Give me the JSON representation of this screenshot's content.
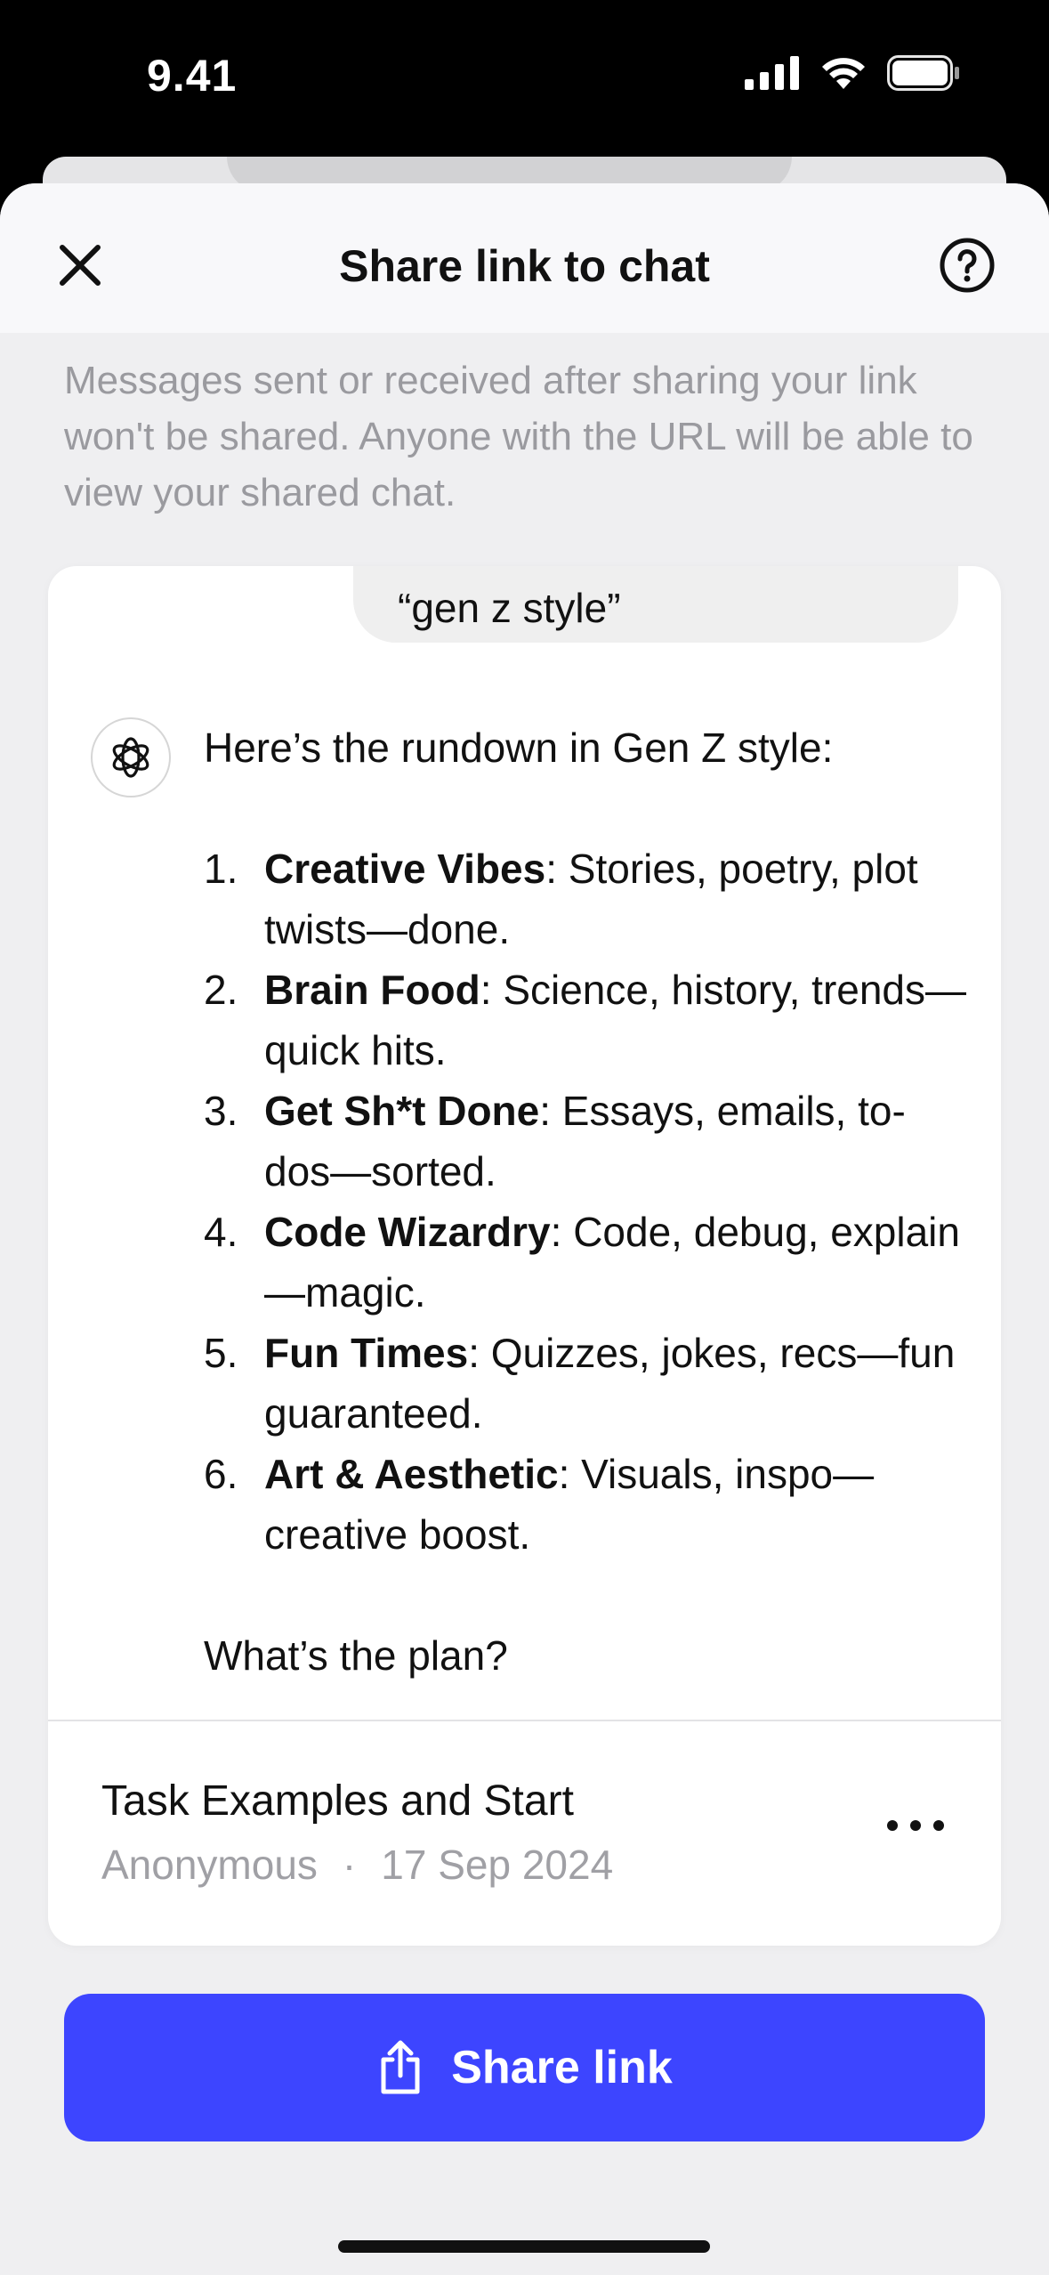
{
  "status_bar": {
    "time": "9.41",
    "icons": [
      "cellular-signal-icon",
      "wifi-icon",
      "battery-icon"
    ]
  },
  "header": {
    "title": "Share link to chat",
    "close_icon": "close-icon",
    "help_icon": "help-icon"
  },
  "description": "Messages sent or received after sharing your link won't be shared. Anyone with the URL will be able to view your shared chat.",
  "conversation": {
    "user_message": "“gen z style”",
    "assistant": {
      "avatar_icon": "openai-logo-icon",
      "intro": "Here’s the rundown in Gen Z style:",
      "items": [
        {
          "num": "1.",
          "title": "Creative Vibes",
          "text": ": Stories, poetry, plot twists—done."
        },
        {
          "num": "2.",
          "title": "Brain Food",
          "text": ": Science, history, trends—quick hits."
        },
        {
          "num": "3.",
          "title": "Get Sh*t Done",
          "text": ": Essays, emails, to-dos—sorted."
        },
        {
          "num": "4.",
          "title": "Code Wizardry",
          "text": ": Code, debug, explain—magic."
        },
        {
          "num": "5.",
          "title": "Fun Times",
          "text": ": Quizzes, jokes, recs—fun guaranteed."
        },
        {
          "num": "6.",
          "title": "Art & Aesthetic",
          "text": ": Visuals, inspo—creative boost."
        }
      ],
      "outro": "What’s the plan?"
    }
  },
  "chat_info": {
    "title": "Task Examples and Start",
    "author": "Anonymous",
    "separator": "·",
    "date": "17 Sep 2024",
    "more_icon": "more-horizontal-icon"
  },
  "share_button": {
    "label": "Share link",
    "icon": "share-icon"
  },
  "colors": {
    "accent": "#3d45ff",
    "sheet_background": "#efeff1",
    "muted_text": "#9a9a9f"
  }
}
